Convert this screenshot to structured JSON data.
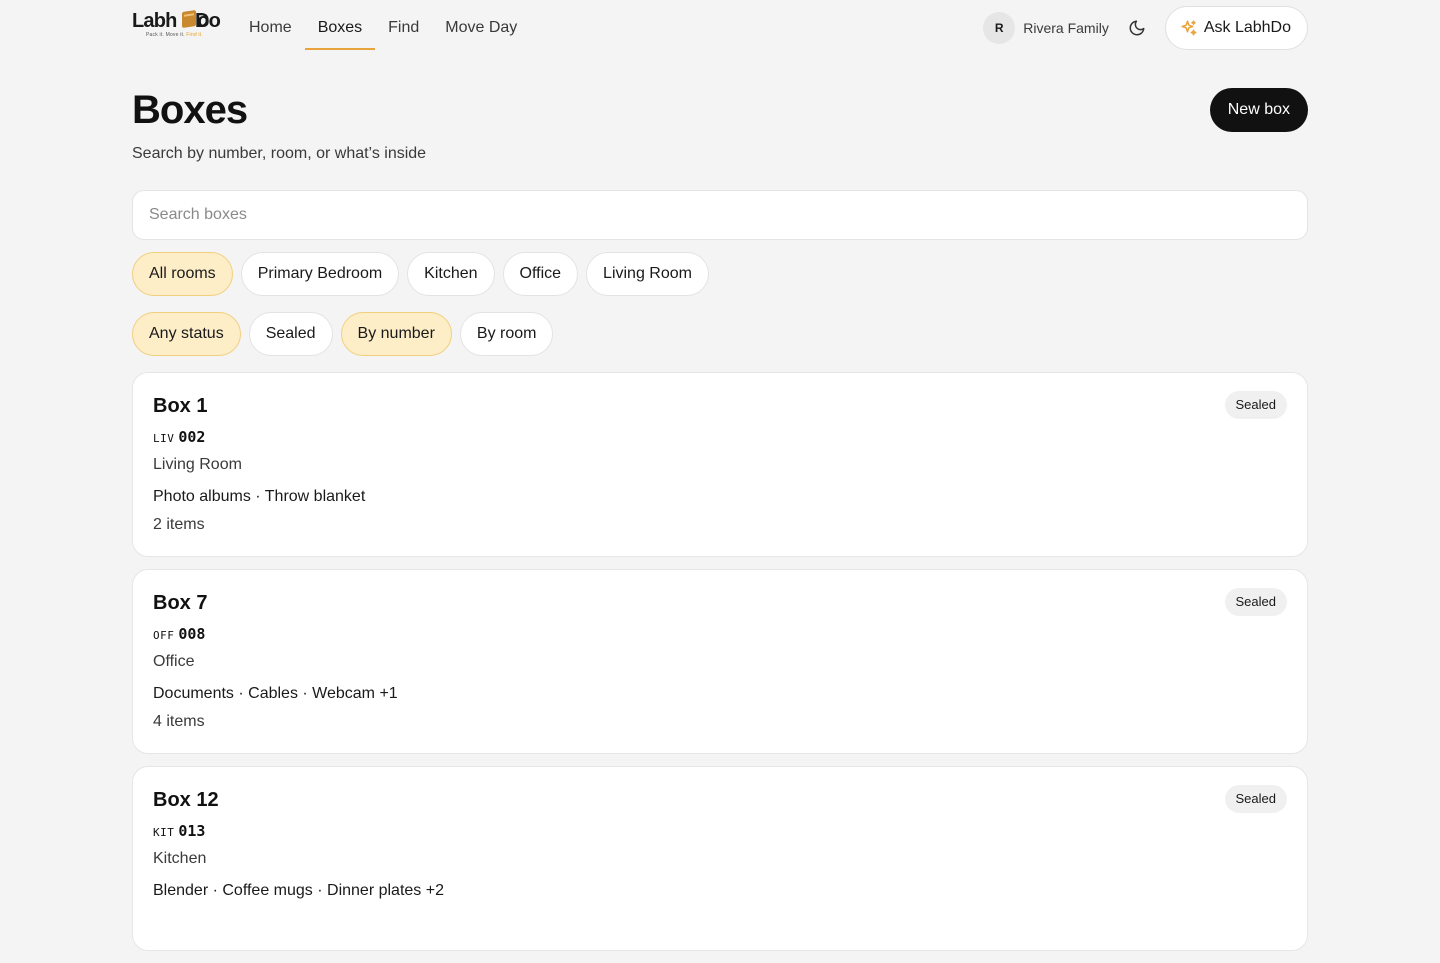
{
  "brand": {
    "name": "LabhDo",
    "tagline_a": "Pack it. Move it.",
    "tagline_b": "Find it."
  },
  "nav": {
    "links": [
      "Home",
      "Boxes",
      "Find",
      "Move Day"
    ],
    "active": "Boxes",
    "user_initial": "R",
    "family_name": "Rivera Family",
    "ask_label": "Ask LabhDo"
  },
  "header": {
    "title": "Boxes",
    "subtitle": "Search by number, room, or what’s inside",
    "new_box_label": "New box"
  },
  "search": {
    "placeholder": "Search boxes",
    "value": ""
  },
  "room_filters": {
    "options": [
      "All rooms",
      "Primary Bedroom",
      "Kitchen",
      "Office",
      "Living Room"
    ],
    "selected": "All rooms"
  },
  "status_filters": {
    "options": [
      "Any status",
      "Sealed"
    ],
    "selected": "Any status"
  },
  "sort": {
    "options": [
      "By number",
      "By room"
    ],
    "selected": "By number"
  },
  "boxes": [
    {
      "title": "Box 1",
      "code_prefix": "LIV",
      "code_number": "002",
      "room": "Living Room",
      "items": "Photo albums · Throw blanket",
      "count": "2 items",
      "status": "Sealed"
    },
    {
      "title": "Box 7",
      "code_prefix": "OFF",
      "code_number": "008",
      "room": "Office",
      "items": "Documents · Cables · Webcam +1",
      "count": "4 items",
      "status": "Sealed"
    },
    {
      "title": "Box 12",
      "code_prefix": "KIT",
      "code_number": "013",
      "room": "Kitchen",
      "items": "Blender · Coffee mugs · Dinner plates +2",
      "count": "",
      "status": "Sealed"
    }
  ],
  "colors": {
    "accent": "#e8a33c",
    "chip_selected_bg": "#fdeec7",
    "page_bg": "#f4f4f4",
    "primary_button": "#111111"
  },
  "icons": {
    "theme_toggle": "moon-icon",
    "ask": "sparkle-icon"
  }
}
